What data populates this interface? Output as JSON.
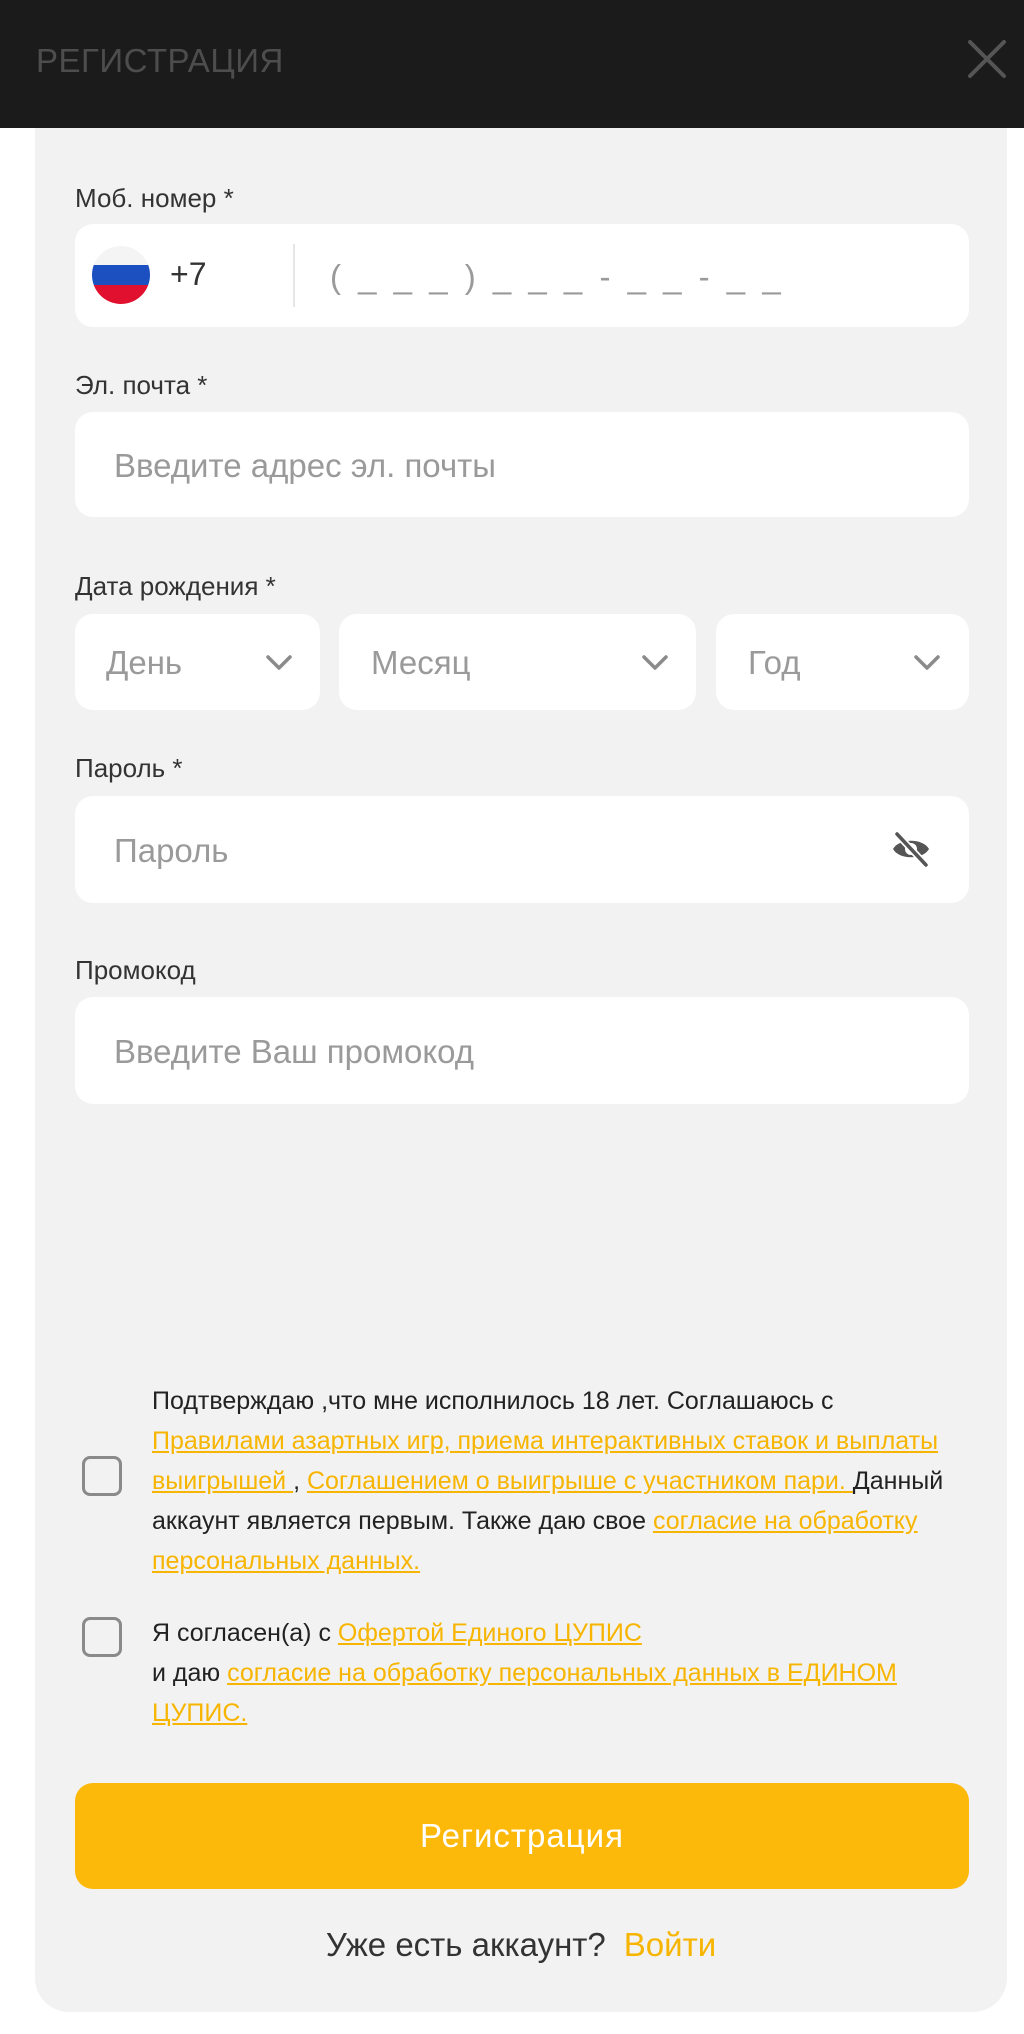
{
  "header": {
    "title": "РЕГИСТРАЦИЯ",
    "close_icon": "close-icon"
  },
  "phone": {
    "label": "Моб. номер *",
    "country_code": "+7",
    "placeholder": "( _ _ _ ) _ _ _ - _ _ - _ _",
    "flag": "russia-flag-icon"
  },
  "email": {
    "label": "Эл. почта *",
    "placeholder": "Введите адрес эл. почты"
  },
  "birthdate": {
    "label": "Дата рождения *",
    "day": "День",
    "month": "Месяц",
    "year": "Год"
  },
  "password": {
    "label": "Пароль *",
    "placeholder": "Пароль",
    "toggle_icon": "eye-off-icon"
  },
  "promo": {
    "label": "Промокод",
    "placeholder": "Введите Ваш промокод"
  },
  "consent1": {
    "text1": "Подтверждаю ,что мне исполнилось 18 лет. Соглашаюсь с ",
    "link1": "Правилами азартных игр, приема интерактивных ставок и выплаты выигрышей ",
    "sep": ", ",
    "link2": "Соглашением о выигрыше с участником пари. ",
    "text2": "Данный аккаунт является первым. Также даю свое ",
    "link3": "согласие на обработку персональных данных."
  },
  "consent2": {
    "text1": "Я согласен(а) с ",
    "link1": "Офертой Единого ЦУПИС",
    "text2": "и даю ",
    "link2": "согласие на обработку персональных данных в ЕДИНОМ ЦУПИС."
  },
  "submit_label": "Регистрация",
  "login": {
    "question": "Уже есть аккаунт?",
    "link": "Войти"
  },
  "colors": {
    "accent": "#fdb90a",
    "link": "#f7b500",
    "card_bg": "#f2f2f2",
    "topbar_bg": "#1b1b1b"
  }
}
